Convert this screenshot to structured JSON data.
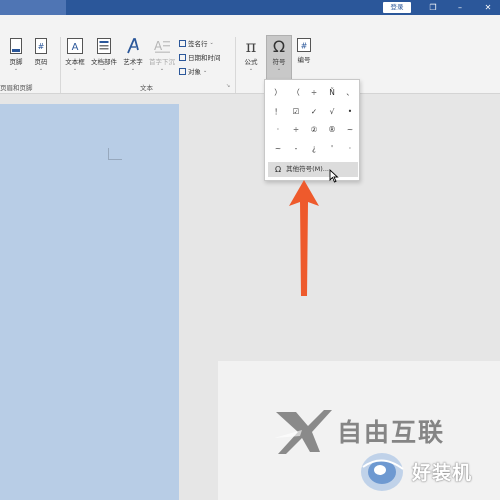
{
  "titlebar": {
    "login_label": "登录",
    "restore_icon": "restore-icon",
    "minimize_icon": "minimize-icon",
    "close_icon": "close-icon"
  },
  "ribbon": {
    "items": [
      {
        "key": "header",
        "label": "页脚",
        "icon": "footer-icon"
      },
      {
        "key": "page_number",
        "label": "页码",
        "icon": "page-number-icon"
      },
      {
        "key": "textbox",
        "label": "文本框",
        "icon": "textbox-icon"
      },
      {
        "key": "doc_parts",
        "label": "文档部件",
        "icon": "doc-parts-icon"
      },
      {
        "key": "wordart",
        "label": "艺术字",
        "icon": "wordart-icon"
      },
      {
        "key": "dropcap",
        "label": "首字下沉",
        "icon": "dropcap-icon"
      },
      {
        "key": "equation",
        "label": "公式",
        "icon": "pi-icon"
      },
      {
        "key": "symbol",
        "label": "符号",
        "icon": "omega-icon"
      },
      {
        "key": "numbering",
        "label": "编号",
        "icon": "hash-icon"
      }
    ],
    "small_items": [
      {
        "label": "签名行",
        "has_dropdown": true
      },
      {
        "label": "日期和时间"
      },
      {
        "label": "对象",
        "has_dropdown": true
      }
    ],
    "groups": {
      "header_footer": "页眉和页脚",
      "text": "文本"
    }
  },
  "symbol_dropdown": {
    "symbols": [
      "）",
      "（",
      "÷",
      "Ñ",
      "、",
      "！",
      "☑",
      "✓",
      "√",
      "•",
      "·",
      "÷",
      "②",
      "®",
      "~",
      "~",
      "-",
      "¿",
      "'",
      "·"
    ],
    "more_label": "其他符号(M)..."
  },
  "watermark": {
    "logo_text": "自由互联",
    "site_text": "好装机"
  },
  "colors": {
    "titlebar": "#2b579a",
    "page_blue": "#b8cde6",
    "arrow": "#ee5a2c"
  }
}
